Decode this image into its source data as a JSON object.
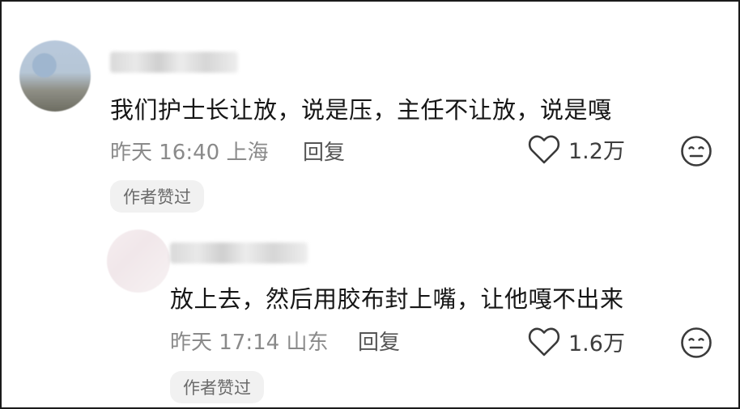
{
  "comments": [
    {
      "text": "我们护士长让放，说是压，主任不让放，说是嘎",
      "meta": "昨天 16:40 上海",
      "reply_label": "回复",
      "likes": "1.2万",
      "badge": "作者赞过"
    },
    {
      "text": "放上去，然后用胶布封上嘴，让他嘎不出来",
      "meta": "昨天 17:14 山东",
      "reply_label": "回复",
      "likes": "1.6万",
      "badge": "作者赞过"
    }
  ],
  "icons": {
    "like": "heart-outline-icon",
    "dislike": "meh-face-icon"
  },
  "colors": {
    "text": "#161616",
    "meta": "#8a8a8a",
    "badge_bg": "#f1f1f1"
  }
}
